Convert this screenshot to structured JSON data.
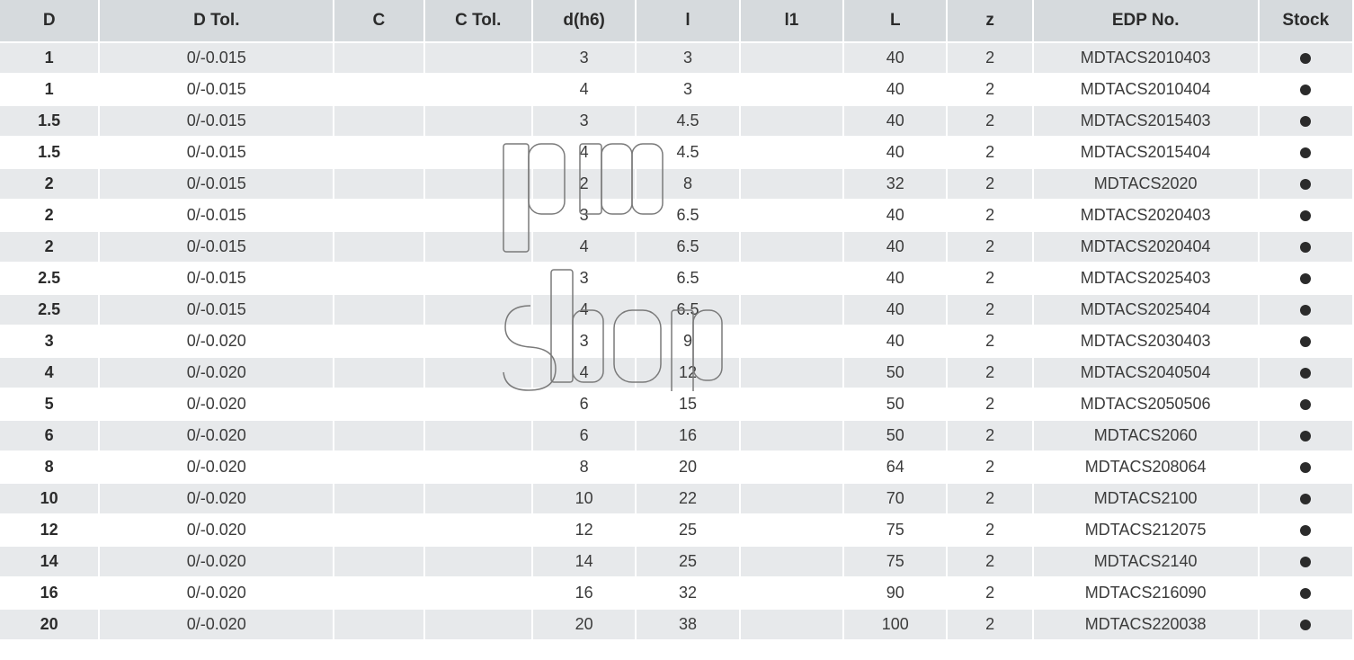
{
  "table": {
    "headers": [
      "D",
      "D Tol.",
      "C",
      "C Tol.",
      "d(h6)",
      "l",
      "l1",
      "L",
      "z",
      "EDP No.",
      "Stock"
    ],
    "rows": [
      {
        "D": "1",
        "DTol": "0/-0.015",
        "C": "",
        "CTol": "",
        "dh6": "3",
        "l": "3",
        "l1": "",
        "L": "40",
        "z": "2",
        "edp": "MDTACS2010403",
        "stock": "●"
      },
      {
        "D": "1",
        "DTol": "0/-0.015",
        "C": "",
        "CTol": "",
        "dh6": "4",
        "l": "3",
        "l1": "",
        "L": "40",
        "z": "2",
        "edp": "MDTACS2010404",
        "stock": "●"
      },
      {
        "D": "1.5",
        "DTol": "0/-0.015",
        "C": "",
        "CTol": "",
        "dh6": "3",
        "l": "4.5",
        "l1": "",
        "L": "40",
        "z": "2",
        "edp": "MDTACS2015403",
        "stock": "●"
      },
      {
        "D": "1.5",
        "DTol": "0/-0.015",
        "C": "",
        "CTol": "",
        "dh6": "4",
        "l": "4.5",
        "l1": "",
        "L": "40",
        "z": "2",
        "edp": "MDTACS2015404",
        "stock": "●"
      },
      {
        "D": "2",
        "DTol": "0/-0.015",
        "C": "",
        "CTol": "",
        "dh6": "2",
        "l": "8",
        "l1": "",
        "L": "32",
        "z": "2",
        "edp": "MDTACS2020",
        "stock": "●"
      },
      {
        "D": "2",
        "DTol": "0/-0.015",
        "C": "",
        "CTol": "",
        "dh6": "3",
        "l": "6.5",
        "l1": "",
        "L": "40",
        "z": "2",
        "edp": "MDTACS2020403",
        "stock": "●"
      },
      {
        "D": "2",
        "DTol": "0/-0.015",
        "C": "",
        "CTol": "",
        "dh6": "4",
        "l": "6.5",
        "l1": "",
        "L": "40",
        "z": "2",
        "edp": "MDTACS2020404",
        "stock": "●"
      },
      {
        "D": "2.5",
        "DTol": "0/-0.015",
        "C": "",
        "CTol": "",
        "dh6": "3",
        "l": "6.5",
        "l1": "",
        "L": "40",
        "z": "2",
        "edp": "MDTACS2025403",
        "stock": "●"
      },
      {
        "D": "2.5",
        "DTol": "0/-0.015",
        "C": "",
        "CTol": "",
        "dh6": "4",
        "l": "6.5",
        "l1": "",
        "L": "40",
        "z": "2",
        "edp": "MDTACS2025404",
        "stock": "●"
      },
      {
        "D": "3",
        "DTol": "0/-0.020",
        "C": "",
        "CTol": "",
        "dh6": "3",
        "l": "9",
        "l1": "",
        "L": "40",
        "z": "2",
        "edp": "MDTACS2030403",
        "stock": "●"
      },
      {
        "D": "4",
        "DTol": "0/-0.020",
        "C": "",
        "CTol": "",
        "dh6": "4",
        "l": "12",
        "l1": "",
        "L": "50",
        "z": "2",
        "edp": "MDTACS2040504",
        "stock": "●"
      },
      {
        "D": "5",
        "DTol": "0/-0.020",
        "C": "",
        "CTol": "",
        "dh6": "6",
        "l": "15",
        "l1": "",
        "L": "50",
        "z": "2",
        "edp": "MDTACS2050506",
        "stock": "●"
      },
      {
        "D": "6",
        "DTol": "0/-0.020",
        "C": "",
        "CTol": "",
        "dh6": "6",
        "l": "16",
        "l1": "",
        "L": "50",
        "z": "2",
        "edp": "MDTACS2060",
        "stock": "●"
      },
      {
        "D": "8",
        "DTol": "0/-0.020",
        "C": "",
        "CTol": "",
        "dh6": "8",
        "l": "20",
        "l1": "",
        "L": "64",
        "z": "2",
        "edp": "MDTACS208064",
        "stock": "●"
      },
      {
        "D": "10",
        "DTol": "0/-0.020",
        "C": "",
        "CTol": "",
        "dh6": "10",
        "l": "22",
        "l1": "",
        "L": "70",
        "z": "2",
        "edp": "MDTACS2100",
        "stock": "●"
      },
      {
        "D": "12",
        "DTol": "0/-0.020",
        "C": "",
        "CTol": "",
        "dh6": "12",
        "l": "25",
        "l1": "",
        "L": "75",
        "z": "2",
        "edp": "MDTACS212075",
        "stock": "●"
      },
      {
        "D": "14",
        "DTol": "0/-0.020",
        "C": "",
        "CTol": "",
        "dh6": "14",
        "l": "25",
        "l1": "",
        "L": "75",
        "z": "2",
        "edp": "MDTACS2140",
        "stock": "●"
      },
      {
        "D": "16",
        "DTol": "0/-0.020",
        "C": "",
        "CTol": "",
        "dh6": "16",
        "l": "32",
        "l1": "",
        "L": "90",
        "z": "2",
        "edp": "MDTACS216090",
        "stock": "●"
      },
      {
        "D": "20",
        "DTol": "0/-0.020",
        "C": "",
        "CTol": "",
        "dh6": "20",
        "l": "38",
        "l1": "",
        "L": "100",
        "z": "2",
        "edp": "MDTACS220038",
        "stock": "●"
      }
    ]
  },
  "watermark": {
    "text": "pm shop"
  }
}
